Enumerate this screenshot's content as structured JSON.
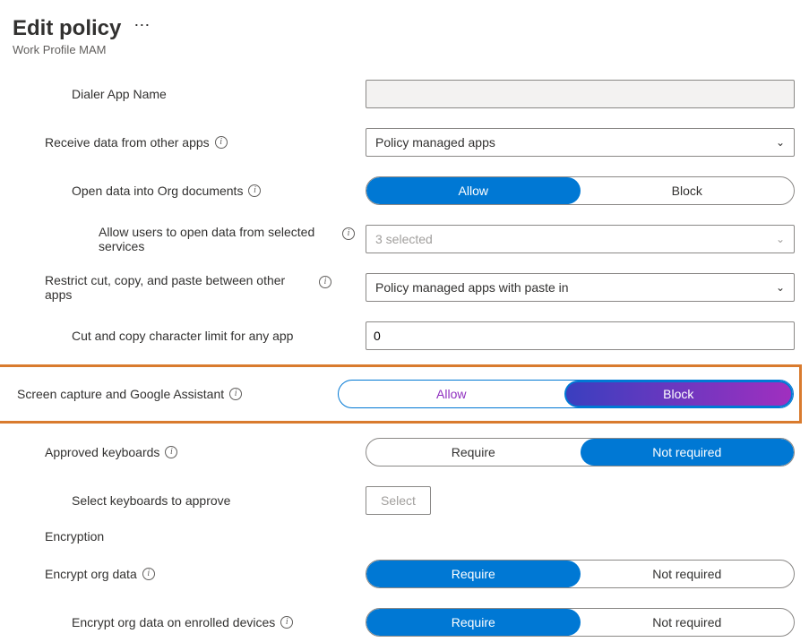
{
  "header": {
    "title": "Edit policy",
    "subtitle": "Work Profile MAM",
    "more_glyph": "⋯"
  },
  "rows": {
    "dialer": {
      "label": "Dialer App Name",
      "value": ""
    },
    "receive": {
      "label": "Receive data from other apps",
      "selected": "Policy managed apps"
    },
    "open_data": {
      "label": "Open data into Org documents",
      "allow": "Allow",
      "block": "Block"
    },
    "allow_services": {
      "label": "Allow users to open data from selected services",
      "summary": "3 selected"
    },
    "restrict": {
      "label": "Restrict cut, copy, and paste between other apps",
      "selected": "Policy managed apps with paste in"
    },
    "cut_limit": {
      "label": "Cut and copy character limit for any app",
      "value": "0"
    },
    "screen_capture": {
      "label": "Screen capture and Google Assistant",
      "allow": "Allow",
      "block": "Block"
    },
    "keyboards": {
      "label": "Approved keyboards",
      "require": "Require",
      "not_required": "Not required"
    },
    "select_kb": {
      "label": "Select keyboards to approve",
      "button": "Select"
    },
    "encryption_head": "Encryption",
    "encrypt_org": {
      "label": "Encrypt org data",
      "require": "Require",
      "not_required": "Not required"
    },
    "encrypt_enrolled": {
      "label": "Encrypt org data on enrolled devices",
      "require": "Require",
      "not_required": "Not required"
    }
  },
  "glyphs": {
    "chevron_down": "⌄",
    "info": "i"
  }
}
